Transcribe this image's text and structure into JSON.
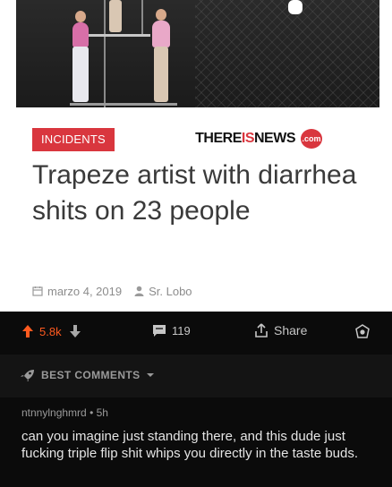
{
  "article": {
    "category": "INCIDENTS",
    "brand_part1": "THERE",
    "brand_part2": "IS",
    "brand_part3": "NEWS",
    "brand_suffix": ".com",
    "headline": "Trapeze artist with diarrhea shits on 23 people",
    "date": "marzo 4, 2019",
    "author": "Sr. Lobo",
    "accent_color": "#d9363e"
  },
  "post_bar": {
    "votes": "5.8k",
    "comments": "119",
    "share_label": "Share",
    "vote_color": "#ff5a1f"
  },
  "comments_section": {
    "sort_label": "BEST COMMENTS",
    "comment": {
      "author": "ntnnylnghmrd",
      "separator": "•",
      "age": "5h",
      "text": "can you imagine just standing there, and this dude just fucking triple flip shit whips you directly in the taste buds."
    }
  }
}
